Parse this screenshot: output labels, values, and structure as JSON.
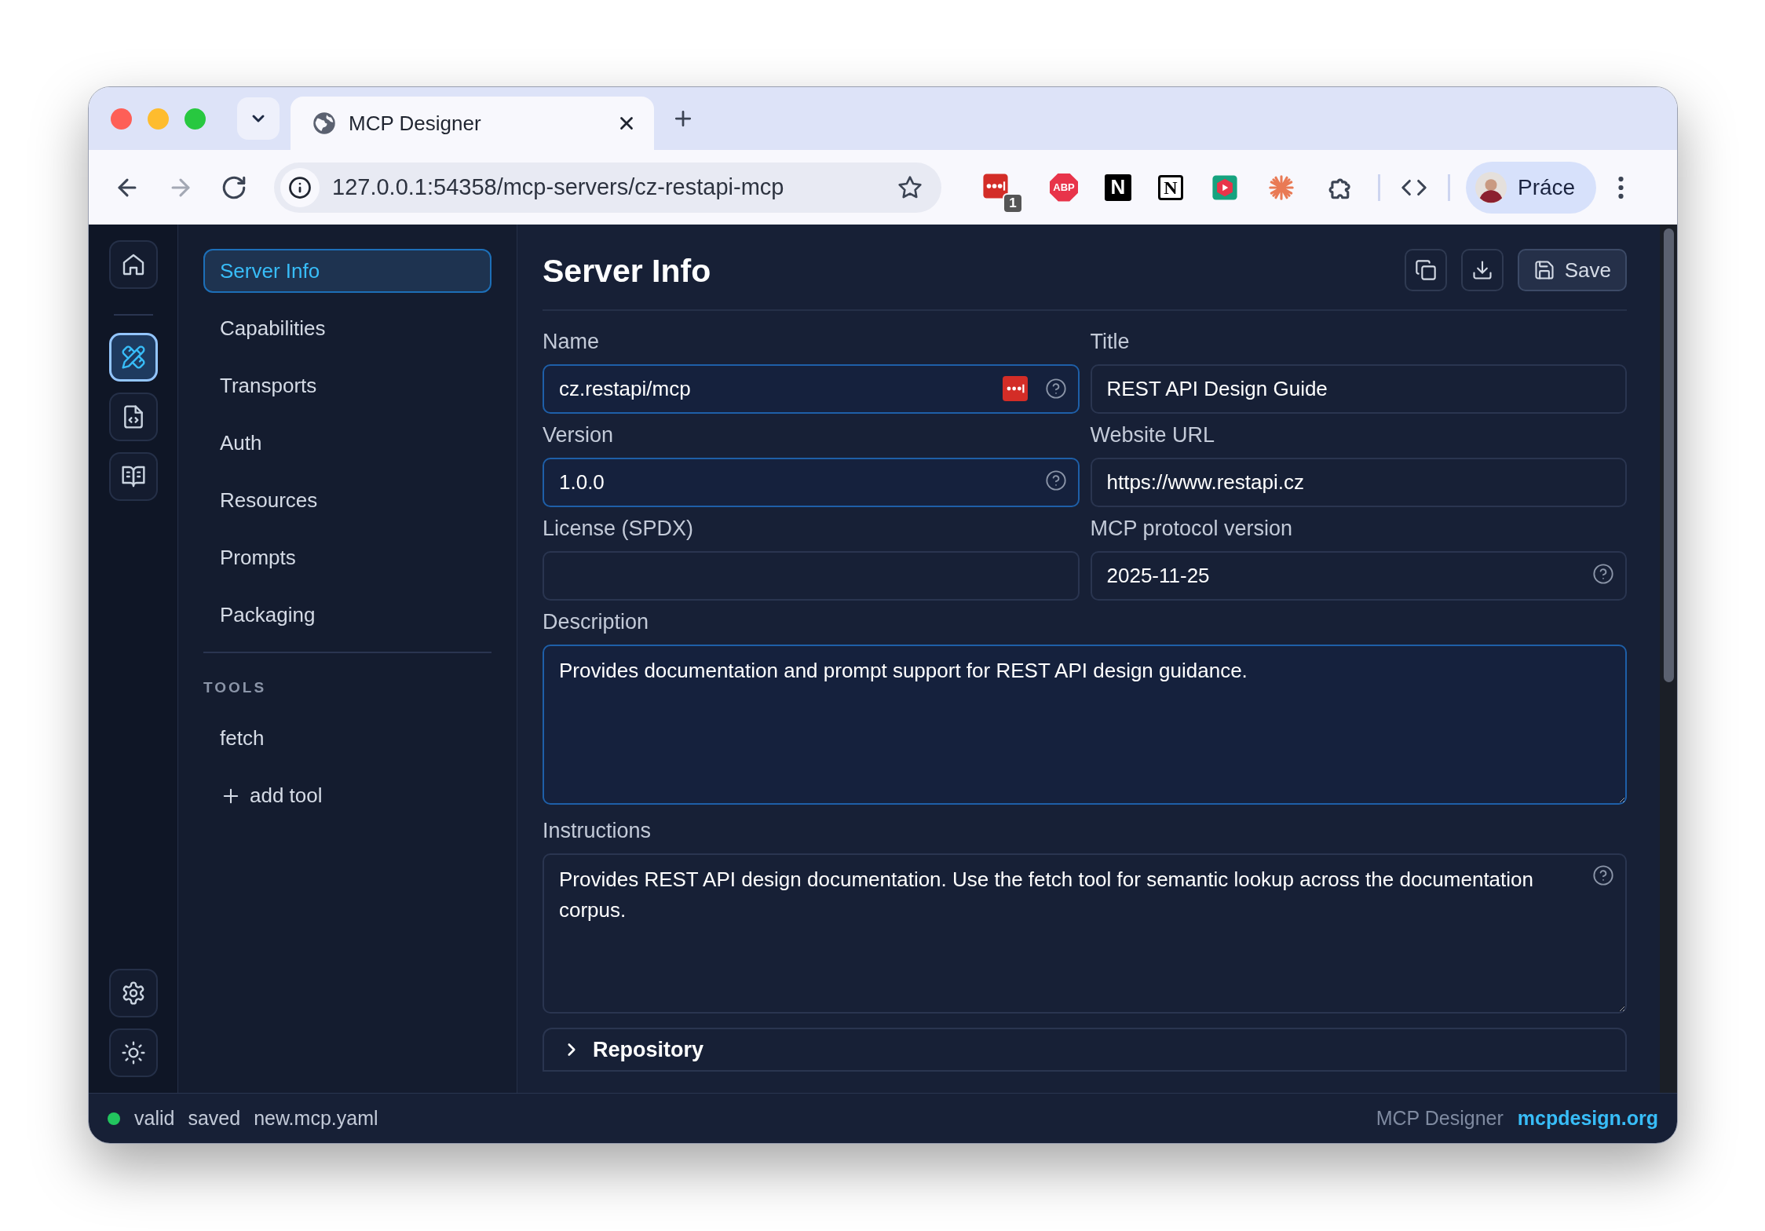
{
  "browser": {
    "tab": {
      "title": "MCP Designer"
    },
    "url": "127.0.0.1:54358/mcp-servers/cz-restapi-mcp",
    "extensions": [
      {
        "kind": "lastpass",
        "badge": "1"
      },
      {
        "kind": "abp",
        "label": "ABP"
      },
      {
        "kind": "n-black",
        "label": "N"
      },
      {
        "kind": "notion",
        "label": "N"
      },
      {
        "kind": "play"
      },
      {
        "kind": "burst"
      },
      {
        "kind": "puzzle"
      }
    ],
    "profile": {
      "label": "Práce"
    }
  },
  "rail": {
    "top": [
      {
        "kind": "home",
        "selected": false
      },
      {
        "kind": "design",
        "selected": true
      },
      {
        "kind": "code",
        "selected": false
      },
      {
        "kind": "book",
        "selected": false
      }
    ],
    "bottom": [
      {
        "kind": "settings"
      },
      {
        "kind": "sun"
      }
    ]
  },
  "nav": {
    "items": [
      {
        "label": "Server Info",
        "selected": true
      },
      {
        "label": "Capabilities",
        "selected": false
      },
      {
        "label": "Transports",
        "selected": false
      },
      {
        "label": "Auth",
        "selected": false
      },
      {
        "label": "Resources",
        "selected": false
      },
      {
        "label": "Prompts",
        "selected": false
      },
      {
        "label": "Packaging",
        "selected": false
      }
    ],
    "tools_heading": "TOOLS",
    "tools": [
      {
        "label": "fetch"
      }
    ],
    "add_tool": "add tool"
  },
  "main": {
    "title": "Server Info",
    "save_label": "Save",
    "fields": [
      {
        "kind": "input",
        "label": "Name",
        "value": "cz.restapi/mcp",
        "focused": true,
        "help": true,
        "password_manager": true
      },
      {
        "kind": "input",
        "label": "Title",
        "value": "REST API Design Guide",
        "focused": false,
        "help": false,
        "password_manager": false
      },
      {
        "kind": "input",
        "label": "Version",
        "value": "1.0.0",
        "focused": true,
        "help": true,
        "password_manager": false
      },
      {
        "kind": "input",
        "label": "Website URL",
        "value": "https://www.restapi.cz",
        "focused": false,
        "help": false,
        "password_manager": false
      },
      {
        "kind": "input",
        "label": "License (SPDX)",
        "focused": false,
        "help": false,
        "password_manager": false
      },
      {
        "kind": "input",
        "label": "MCP protocol version",
        "value": "2025-11-25",
        "focused": false,
        "help": true,
        "password_manager": false
      },
      {
        "kind": "textarea",
        "label": "Description",
        "value": "Provides documentation and prompt support for REST API design guidance.",
        "focused": true,
        "help": false,
        "password_manager": false
      },
      {
        "kind": "textarea",
        "label": "Instructions",
        "value": "Provides REST API design documentation. Use the fetch tool for semantic lookup across the documentation corpus.",
        "focused": false,
        "help": true,
        "password_manager": false
      }
    ],
    "sections": [
      {
        "label": "Repository",
        "expanded": false
      }
    ]
  },
  "status": {
    "valid": true,
    "state": "valid",
    "saved": "saved",
    "file": "new.mcp.yaml",
    "app": "MCP Designer",
    "link": "mcpdesign.org"
  }
}
